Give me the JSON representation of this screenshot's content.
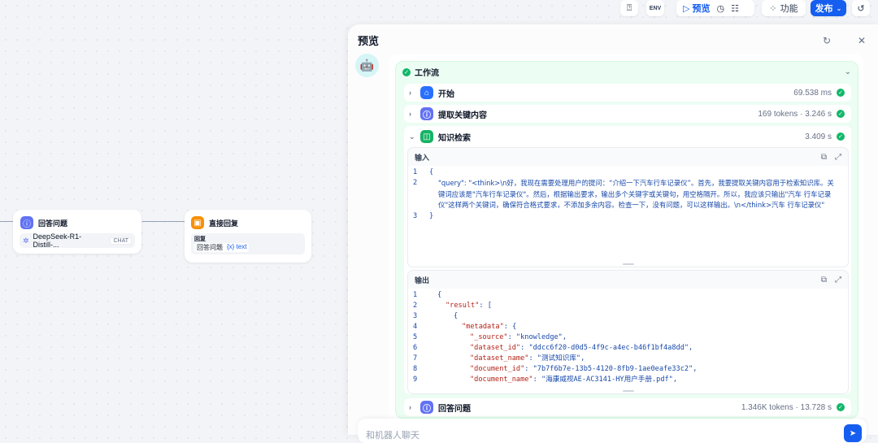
{
  "toolbar": {
    "variable_icon": "variable-icon",
    "env_label": "ENV",
    "preview_label": "预览",
    "features_label": "功能",
    "publish_label": "发布"
  },
  "canvas": {
    "llm_node": {
      "title": "回答问题",
      "model": "DeepSeek-R1-Distill-...",
      "model_badge": "CHAT"
    },
    "answer_node": {
      "title": "直接回复",
      "field_label": "回复",
      "ref_node": "回答问题",
      "ref_var": "{x} text"
    }
  },
  "preview": {
    "title": "预览",
    "workflow_label": "工作流",
    "steps": [
      {
        "name": "开始",
        "meta": "69.538 ms",
        "color": "#2970ff"
      },
      {
        "name": "提取关键内容",
        "meta": "169 tokens · 3.246 s",
        "color": "#6172f3"
      },
      {
        "name": "知识检索",
        "meta": "3.409 s",
        "color": "#16b364"
      },
      {
        "name": "回答问题",
        "meta": "1.346K tokens · 13.728 s",
        "color": "#6172f3"
      }
    ],
    "input": {
      "label": "输入",
      "lines": [
        "{",
        "\"query\": \"<think>\\n好，我现在需要处理用户的提问：“介绍一下汽车行车记录仪”。首先，我要提取关键内容用于检索知识库。关键词应该是\"汽车行车记录仪\"。然后，根据输出要求，输出多个关键字或关键句，用空格隔开。所以，我应该只输出\"汽车 行车记录仪\"这样两个关键词，确保符合格式要求，不添加多余内容。检查一下，没有问题，可以这样输出。\\n</think>汽车 行车记录仪\"",
        "}"
      ]
    },
    "output": {
      "label": "输出",
      "lines": [
        {
          "k": "",
          "v": "{"
        },
        {
          "k": "\"result\"",
          "v": ": ["
        },
        {
          "k": "",
          "v": "{"
        },
        {
          "k": "\"metadata\"",
          "v": ": {"
        },
        {
          "k": "\"_source\"",
          "v": ": \"knowledge\","
        },
        {
          "k": "\"dataset_id\"",
          "v": ": \"ddcc6f20-d0d5-4f9c-a4ec-b46f1bf4a8dd\","
        },
        {
          "k": "\"dataset_name\"",
          "v": ": \"测试知识库\","
        },
        {
          "k": "\"document_id\"",
          "v": ": \"7b7f6b7e-13b5-4120-8fb9-1ae0eafe33c2\","
        },
        {
          "k": "\"document_name\"",
          "v": ": \"海康威视AE-AC3141-HY用户手册.pdf\","
        }
      ]
    },
    "chat_placeholder": "和机器人聊天"
  }
}
